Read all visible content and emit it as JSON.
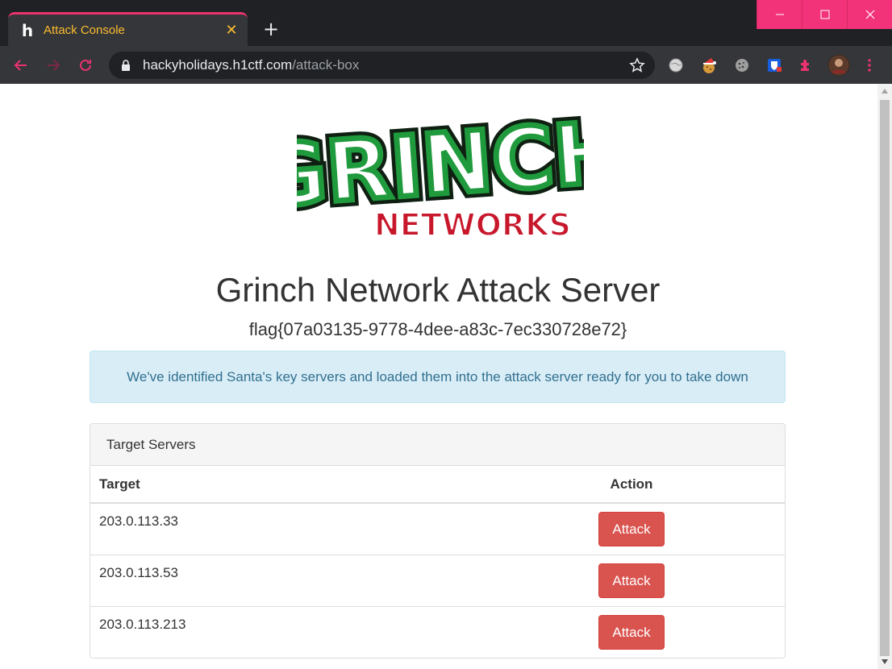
{
  "browser": {
    "tab": {
      "title": "Attack Console",
      "favicon": "h",
      "close_glyph": "✕"
    },
    "new_tab_glyph": "+",
    "url": {
      "host": "hackyholidays.h1ctf.com",
      "path": "/attack-box"
    },
    "extensions": [
      "globe-extension-icon",
      "santa-cookie-extension-icon",
      "cookie-extension-icon",
      "bitwarden-extension-icon",
      "puzzle-extensions-icon",
      "profile-avatar"
    ],
    "colors": {
      "accent": "#f2337a",
      "tab_text": "#fbbc2e"
    }
  },
  "page": {
    "logo": {
      "word1": "GRINCH",
      "word2": "NETWORKS"
    },
    "title": "Grinch Network Attack Server",
    "flag": "flag{07a03135-9778-4dee-a83c-7ec330728e72}",
    "alert": "We've identified Santa's key servers and loaded them into the attack server ready for you to take down",
    "panel": {
      "heading": "Target Servers",
      "columns": {
        "target": "Target",
        "action": "Action"
      },
      "rows": [
        {
          "target": "203.0.113.33",
          "action_label": "Attack"
        },
        {
          "target": "203.0.113.53",
          "action_label": "Attack"
        },
        {
          "target": "203.0.113.213",
          "action_label": "Attack"
        }
      ]
    },
    "colors": {
      "attack_button": "#d9534f",
      "alert_bg": "#d9edf7",
      "logo_green": "#1f9a3c",
      "logo_red": "#c8172b"
    }
  }
}
